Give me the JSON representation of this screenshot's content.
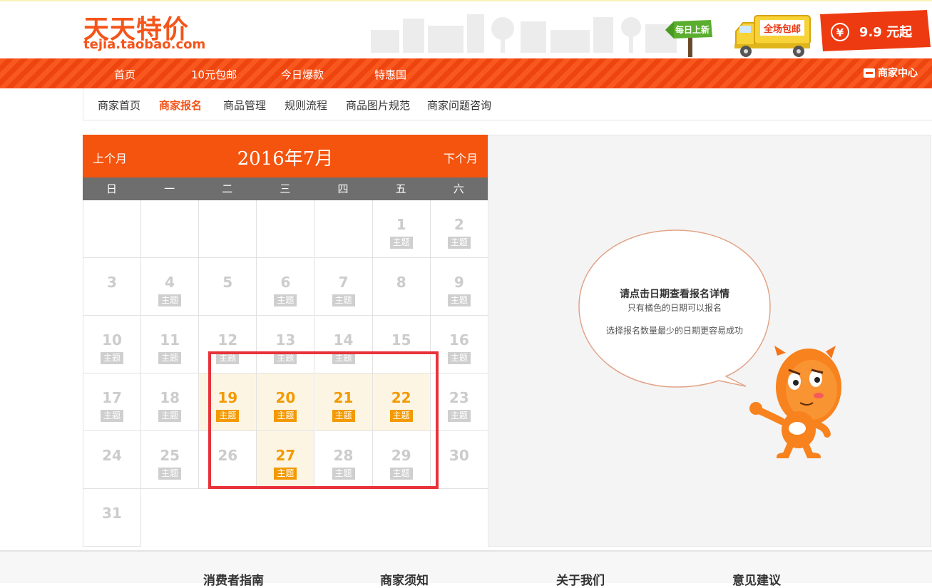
{
  "header": {
    "logo_cn": "天天特价",
    "logo_en": "tejia.taobao.com",
    "sign_text": "每日上新",
    "truck_text": "全场包邮",
    "price_text": "9.9 元起",
    "price_symbol": "¥"
  },
  "nav": {
    "items": [
      "首页",
      "10元包邮",
      "今日爆款",
      "特惠国"
    ],
    "merchant_center": "商家中心"
  },
  "subnav": {
    "items": [
      "商家首页",
      "商家报名",
      "商品管理",
      "规则流程",
      "商品图片规范",
      "商家问题咨询"
    ],
    "active": "商家报名"
  },
  "calendar": {
    "prev": "上个月",
    "next": "下个月",
    "month_label": "2016年7月",
    "weekdays": [
      "日",
      "一",
      "二",
      "三",
      "四",
      "五",
      "六"
    ],
    "tag_label": "主题",
    "first_weekday": 5,
    "days_in_month": 31,
    "days_with_tag": [
      1,
      2,
      4,
      6,
      7,
      9,
      10,
      11,
      12,
      13,
      14,
      16,
      17,
      18,
      19,
      20,
      21,
      22,
      23,
      25,
      27,
      28,
      29
    ],
    "active_days": [
      19,
      20,
      21,
      22,
      27
    ]
  },
  "tips": {
    "title": "请点击日期查看报名详情",
    "line1": "只有橘色的日期可以报名",
    "line2": "选择报名数量最少的日期更容易成功"
  },
  "footer": {
    "items": [
      "消费者指南",
      "商家须知",
      "关于我们",
      "意见建议"
    ]
  },
  "colors": {
    "brand": "#f5541a",
    "calendar_header": "#f5540e",
    "active_day": "#f39a00",
    "highlight_border": "#e8323a"
  }
}
